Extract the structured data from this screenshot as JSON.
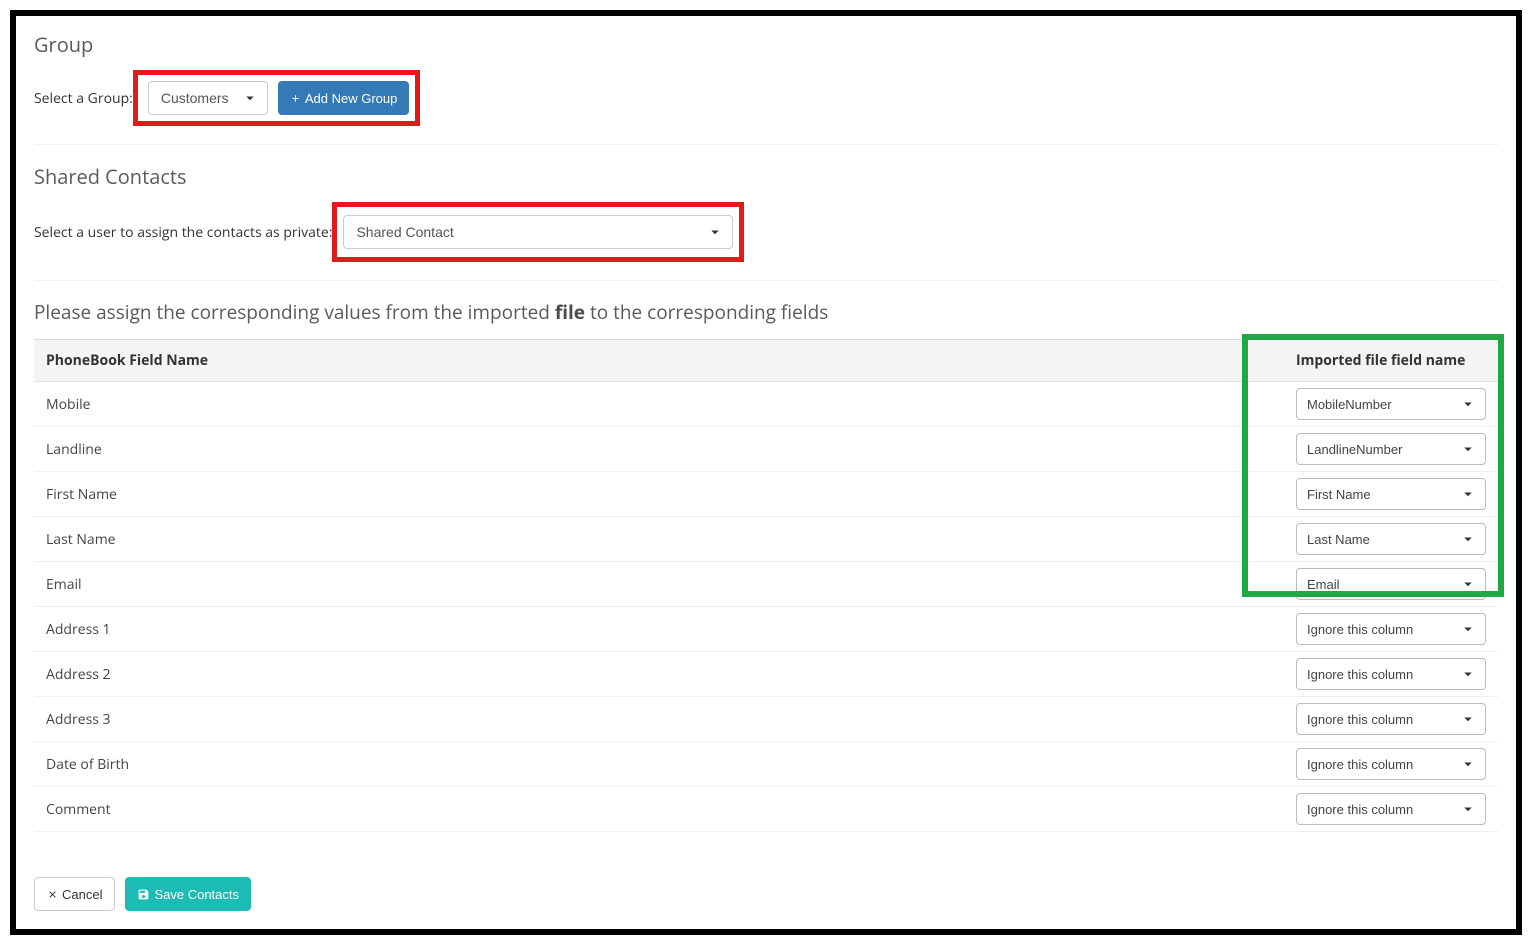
{
  "group": {
    "title": "Group",
    "label": "Select a Group:",
    "selected": "Customers",
    "add_button": "Add New Group"
  },
  "shared": {
    "title": "Shared Contacts",
    "label": "Select a user to assign the contacts as private:",
    "selected": "Shared Contact"
  },
  "assign_text_prefix": "Please assign the corresponding values from the imported ",
  "assign_text_bold": "file",
  "assign_text_suffix": " to the corresponding fields",
  "table": {
    "header_field": "PhoneBook Field Name",
    "header_imported": "Imported file field name",
    "rows": [
      {
        "field": "Mobile",
        "value": "MobileNumber"
      },
      {
        "field": "Landline",
        "value": "LandlineNumber"
      },
      {
        "field": "First Name",
        "value": "First Name"
      },
      {
        "field": "Last Name",
        "value": "Last Name"
      },
      {
        "field": "Email",
        "value": "Email"
      },
      {
        "field": "Address 1",
        "value": "Ignore this column"
      },
      {
        "field": "Address 2",
        "value": "Ignore this column"
      },
      {
        "field": "Address 3",
        "value": "Ignore this column"
      },
      {
        "field": "Date of Birth",
        "value": "Ignore this column"
      },
      {
        "field": "Comment",
        "value": "Ignore this column"
      }
    ]
  },
  "footer": {
    "cancel": "Cancel",
    "save": "Save Contacts"
  }
}
